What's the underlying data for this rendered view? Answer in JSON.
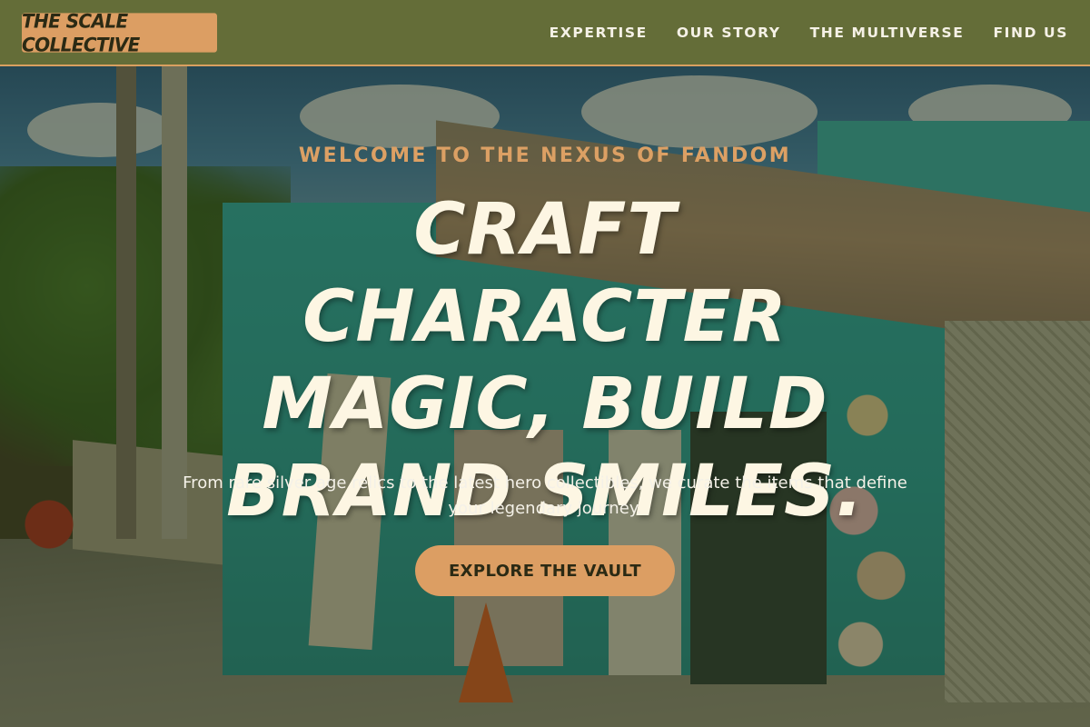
{
  "header": {
    "logo_text": "THE SCALE COLLECTIVE",
    "nav": [
      {
        "label": "EXPERTISE"
      },
      {
        "label": "OUR STORY"
      },
      {
        "label": "THE MULTIVERSE"
      },
      {
        "label": "FIND US"
      }
    ]
  },
  "hero": {
    "kicker": "WELCOME TO THE NEXUS OF FANDOM",
    "headline": "CRAFT CHARACTER MAGIC, BUILD BRAND SMILES.",
    "subtext": "From rare silver age relics to the latest hero collectibles, we curate the items that define your legendary journey.",
    "cta_label": "EXPLORE THE VAULT"
  },
  "colors": {
    "header_bg": "#646d38",
    "accent": "#dc9e63",
    "headline": "#fdf6e3"
  }
}
